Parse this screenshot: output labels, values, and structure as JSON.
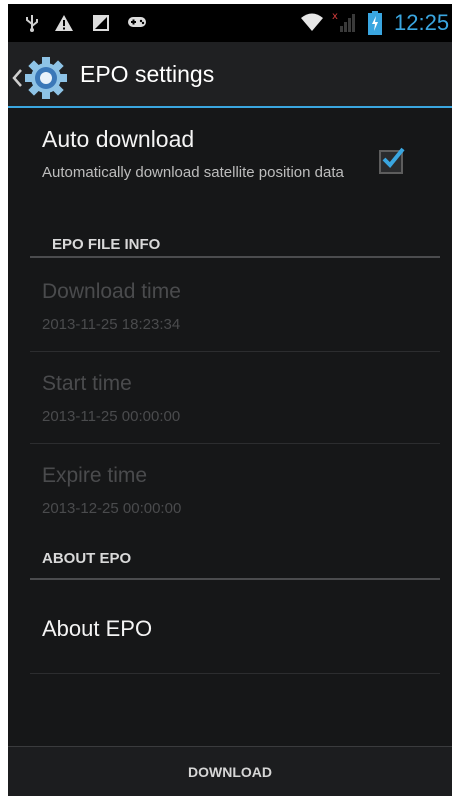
{
  "status_bar": {
    "time": "12:25",
    "icons": [
      "usb-icon",
      "warning-icon",
      "image-icon",
      "game-controller-icon",
      "wifi-icon",
      "signal-icon",
      "battery-icon"
    ]
  },
  "action_bar": {
    "title": "EPO settings",
    "icon": "gear-icon",
    "accent": "#3aa6e0"
  },
  "auto_download": {
    "title": "Auto download",
    "summary": "Automatically download satellite position data",
    "checked": true
  },
  "epo_file_info": {
    "header": "EPO FILE INFO",
    "items": [
      {
        "title": "Download time",
        "value": "2013-11-25 18:23:34"
      },
      {
        "title": "Start time",
        "value": "2013-11-25 00:00:00"
      },
      {
        "title": "Expire time",
        "value": "2013-12-25 00:00:00"
      }
    ]
  },
  "about_epo": {
    "header": "ABOUT EPO",
    "item_title": "About EPO"
  },
  "footer": {
    "download_label": "DOWNLOAD"
  }
}
